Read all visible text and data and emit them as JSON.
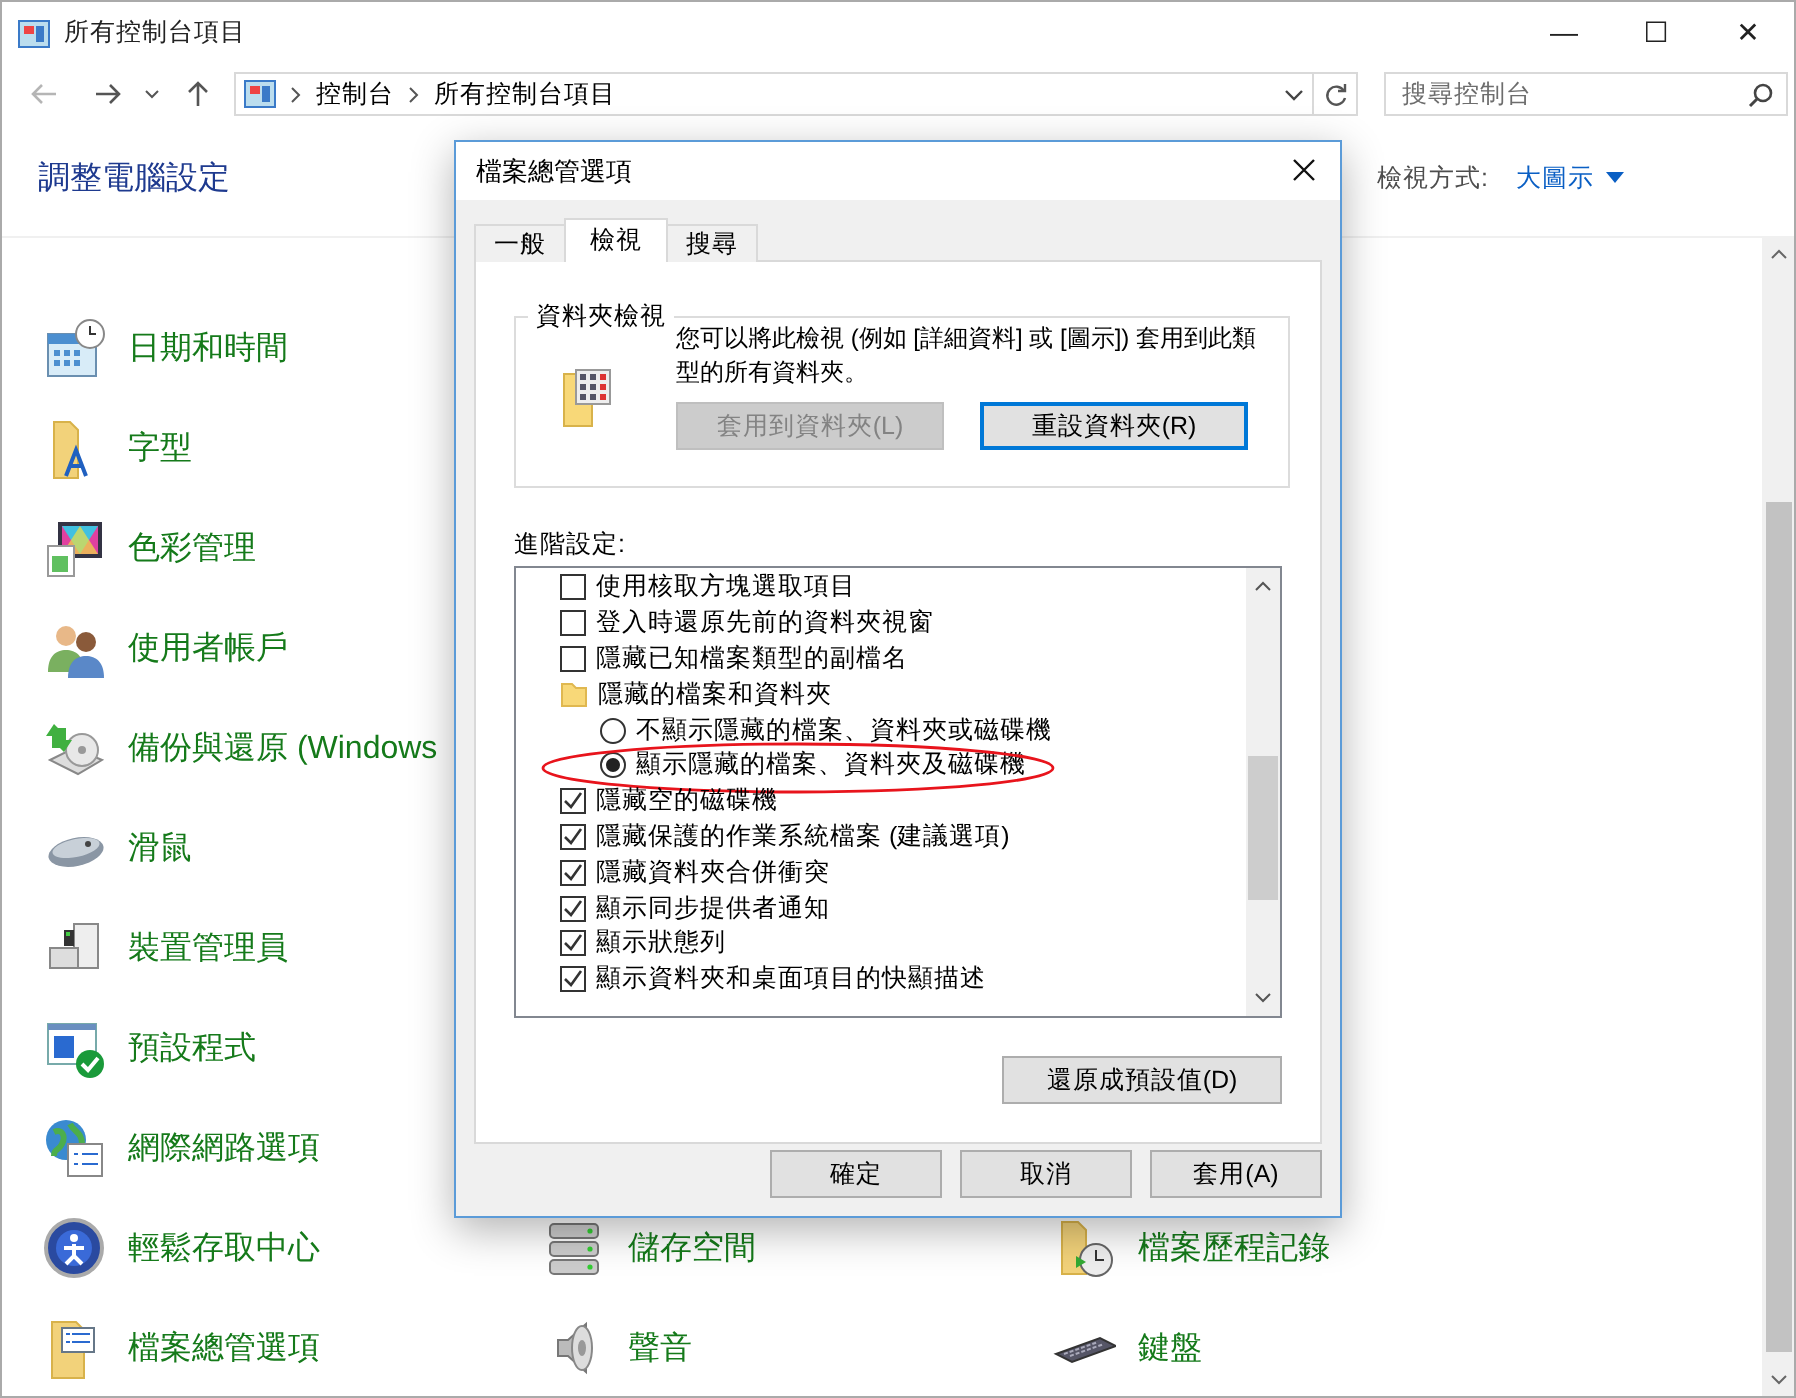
{
  "window": {
    "title": "所有控制台項目",
    "controls": [
      "—",
      "☐",
      "✕"
    ]
  },
  "nav": {
    "breadcrumbs": [
      "控制台",
      "所有控制台項目"
    ],
    "search": {
      "placeholder": "搜尋控制台"
    }
  },
  "header": {
    "title": "調整電腦設定",
    "view_label": "檢視方式:",
    "view_value": "大圖示"
  },
  "items": [
    [
      {
        "label": "日期和時間"
      }
    ],
    [
      {
        "label": "字型"
      }
    ],
    [
      {
        "label": "色彩管理"
      }
    ],
    [
      {
        "label": "使用者帳戶"
      }
    ],
    [
      {
        "label": "備份與還原 (Windows"
      }
    ],
    [
      {
        "label": "滑鼠"
      }
    ],
    [
      {
        "label": "裝置管理員"
      }
    ],
    [
      {
        "label": "預設程式"
      }
    ],
    [
      {
        "label": "網際網路選項"
      }
    ],
    [
      {
        "label": "輕鬆存取中心"
      },
      {
        "label": "儲存空間"
      },
      {
        "label": "檔案歷程記錄"
      }
    ],
    [
      {
        "label": "檔案總管選項"
      },
      {
        "label": "聲音"
      },
      {
        "label": "鍵盤"
      }
    ]
  ],
  "dialog": {
    "title": "檔案總管選項",
    "tabs": [
      {
        "label": "一般",
        "selected": false
      },
      {
        "label": "檢視",
        "selected": true
      },
      {
        "label": "搜尋",
        "selected": false
      }
    ],
    "folder_views": {
      "legend": "資料夾檢視",
      "text": "您可以將此檢視 (例如 [詳細資料] 或 [圖示]) 套用到此類型的所有資料夾。",
      "buttons": [
        {
          "label": "套用到資料夾(L)",
          "disabled": true,
          "focused": false
        },
        {
          "label": "重設資料夾(R)",
          "disabled": false,
          "focused": true
        }
      ]
    },
    "advanced_label": "進階設定:",
    "advanced": [
      {
        "kind": "checkbox",
        "label": "使用核取方塊選取項目",
        "checked": false
      },
      {
        "kind": "checkbox",
        "label": "登入時還原先前的資料夾視窗",
        "checked": false
      },
      {
        "kind": "checkbox",
        "label": "隱藏已知檔案類型的副檔名",
        "checked": false
      },
      {
        "kind": "folder",
        "label": "隱藏的檔案和資料夾",
        "children": [
          {
            "kind": "radio",
            "label": "不顯示隱藏的檔案、資料夾或磁碟機",
            "selected": false,
            "highlighted": false
          },
          {
            "kind": "radio",
            "label": "顯示隱藏的檔案、資料夾及磁碟機",
            "selected": true,
            "highlighted": true
          }
        ]
      },
      {
        "kind": "checkbox",
        "label": "隱藏空的磁碟機",
        "checked": true
      },
      {
        "kind": "checkbox",
        "label": "隱藏保護的作業系統檔案 (建議選項)",
        "checked": true
      },
      {
        "kind": "checkbox",
        "label": "隱藏資料夾合併衝突",
        "checked": true
      },
      {
        "kind": "checkbox",
        "label": "顯示同步提供者通知",
        "checked": true
      },
      {
        "kind": "checkbox",
        "label": "顯示狀態列",
        "checked": true
      },
      {
        "kind": "checkbox",
        "label": "顯示資料夾和桌面項目的快顯描述",
        "checked": true
      }
    ],
    "restore_button": "還原成預設值(D)",
    "buttons": [
      "確定",
      "取消",
      "套用(A)"
    ]
  }
}
